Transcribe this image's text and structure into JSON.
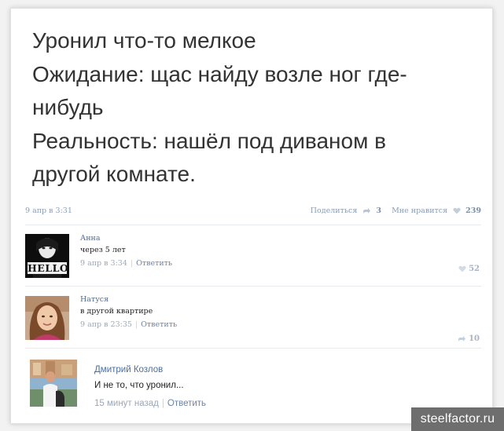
{
  "post": {
    "lines": [
      "Уронил что-то мелкое",
      "Ожидание: щас найду возле ног где-",
      "нибудь",
      "Реальность: нашёл под диваном в",
      "другой комнате."
    ],
    "date": "9 апр в 3:31",
    "share_label": "Поделиться",
    "share_count": "3",
    "like_label": "Мне нравится",
    "like_count": "239"
  },
  "comments": [
    {
      "author": "Анна",
      "text": "через 5 лет",
      "time": "9 апр в 3:34",
      "reply_label": "Ответить",
      "likes": "52",
      "avatar_caption": "HELLO"
    },
    {
      "author": "Натуся",
      "text": "в другой квартире",
      "time": "9 апр в 23:35",
      "reply_label": "Ответить",
      "likes": "10"
    },
    {
      "author": "Дмитрий Козлов",
      "text": "И не то, что уронил...",
      "time": "15 минут назад",
      "reply_label": "Ответить"
    }
  ],
  "watermark": "steelfactor.ru",
  "colors": {
    "link": "#4a6fa5",
    "meta": "#8a9db5",
    "divider": "#e6e9ee",
    "watermark_bg": "#6e6e6e"
  }
}
